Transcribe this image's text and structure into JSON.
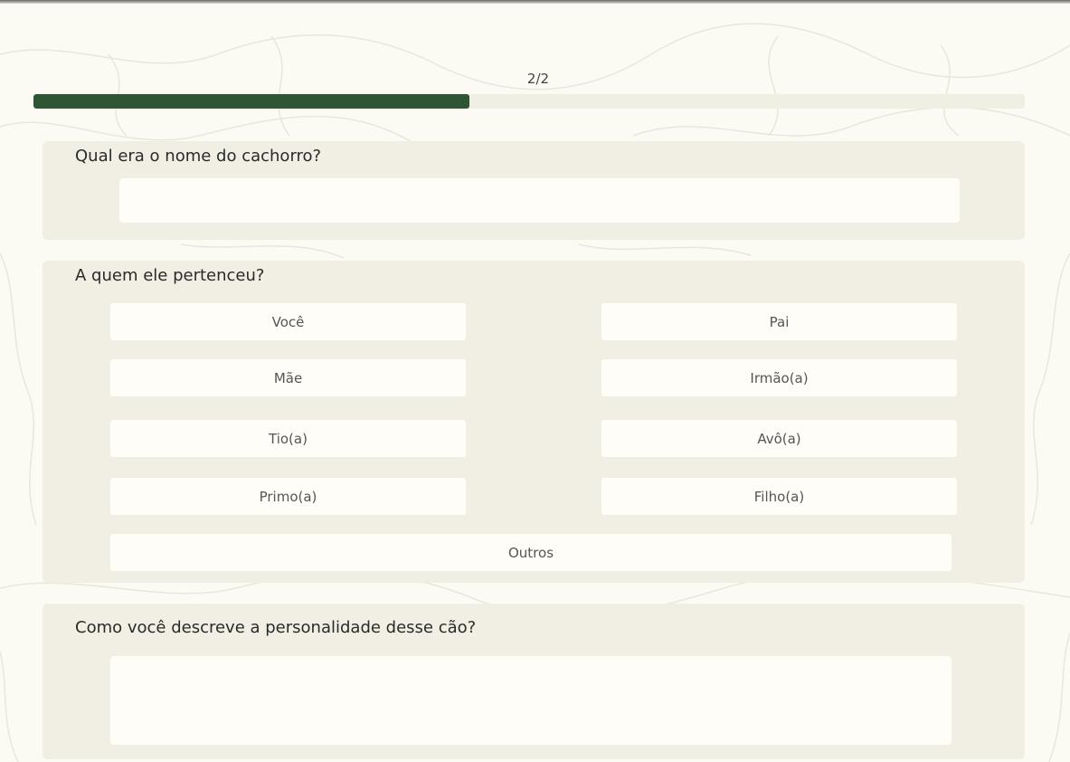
{
  "progress": {
    "label": "2/2",
    "value_fraction": 0.44
  },
  "questions": [
    {
      "title": "Qual era o nome do cachorro?",
      "input_value": ""
    },
    {
      "title": "A quem ele pertenceu?",
      "options": [
        "Você",
        "Pai",
        "Mãe",
        "Irmão(a)",
        "Tio(a)",
        "Avô(a)",
        "Primo(a)",
        "Filho(a)",
        "Outros"
      ]
    },
    {
      "title": "Como você descreve a personalidade desse cão?",
      "textarea_value": ""
    }
  ],
  "colors": {
    "background": "#fcfbf3",
    "card": "#f1eee3",
    "field": "#fefdf7",
    "accent": "#2f5535"
  }
}
